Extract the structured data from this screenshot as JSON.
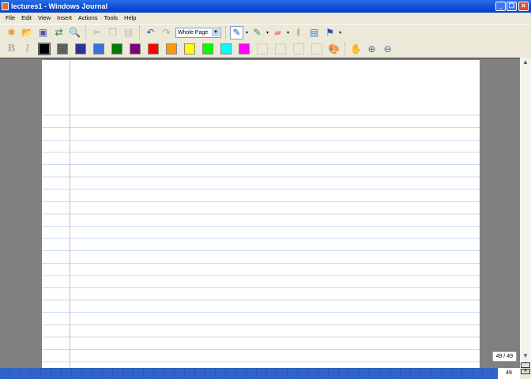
{
  "window": {
    "title": "lectures1 - Windows Journal",
    "minimize": "_",
    "restore": "❐",
    "close": "✕"
  },
  "menu": [
    "File",
    "Edit",
    "View",
    "Insert",
    "Actions",
    "Tools",
    "Help"
  ],
  "toolbar": {
    "zoom_select": "Whole Page",
    "icons": [
      "new-note-icon",
      "open-icon",
      "save-icon",
      "send-icon",
      "find-icon",
      "cut-icon",
      "copy-icon",
      "paste-icon",
      "undo-icon",
      "redo-icon",
      "pen-icon",
      "highlighter-icon",
      "eraser-icon",
      "lasso-icon",
      "insert-space-icon",
      "flag-icon"
    ]
  },
  "format": {
    "bold": "B",
    "italic": "I",
    "colors": [
      "#000000",
      "#606060",
      "#2e3192",
      "#3a6fe0",
      "#007a00",
      "#800080",
      "#ff0000",
      "#ff9900",
      "#ffff00",
      "#00ff00",
      "#00ffff",
      "#ff00ff"
    ]
  },
  "status": {
    "page_indicator": "49 / 49",
    "page_number": "49"
  }
}
